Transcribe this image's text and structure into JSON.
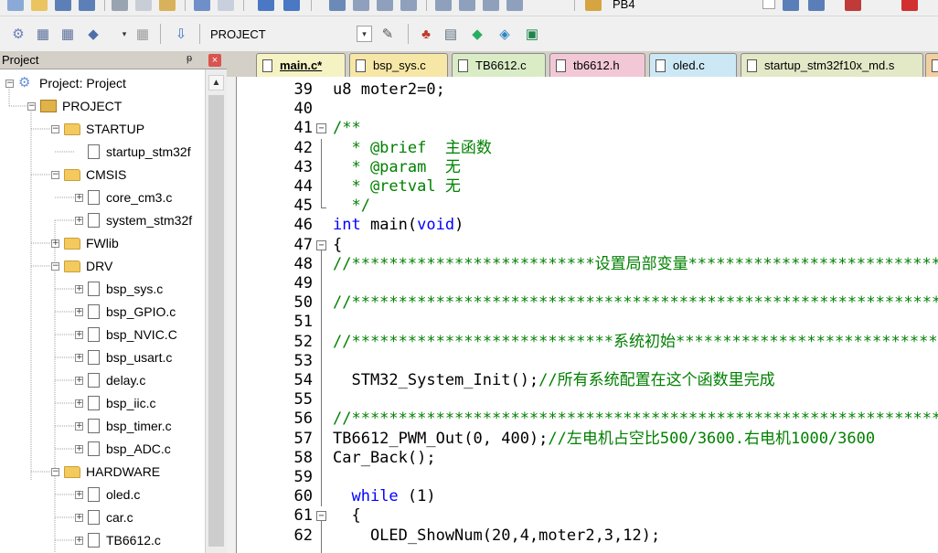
{
  "toolbar1": {
    "partial_label": "PB4"
  },
  "toolbar2": {
    "target_name": "PROJECT"
  },
  "project_panel": {
    "title": "Project",
    "pin_glyph": "ᵽ",
    "tree": [
      {
        "label": "Project: Project",
        "level": 0,
        "kind": "root"
      },
      {
        "label": "PROJECT",
        "level": 1,
        "kind": "target"
      },
      {
        "label": "STARTUP",
        "level": 2,
        "kind": "folder"
      },
      {
        "label": "startup_stm32f",
        "level": 3,
        "kind": "file-noexp"
      },
      {
        "label": "CMSIS",
        "level": 2,
        "kind": "folder"
      },
      {
        "label": "core_cm3.c",
        "level": 3,
        "kind": "file"
      },
      {
        "label": "system_stm32f",
        "level": 3,
        "kind": "file"
      },
      {
        "label": "FWlib",
        "level": 2,
        "kind": "folder-collapsed"
      },
      {
        "label": "DRV",
        "level": 2,
        "kind": "folder"
      },
      {
        "label": "bsp_sys.c",
        "level": 3,
        "kind": "file"
      },
      {
        "label": "bsp_GPIO.c",
        "level": 3,
        "kind": "file"
      },
      {
        "label": "bsp_NVIC.C",
        "level": 3,
        "kind": "file"
      },
      {
        "label": "bsp_usart.c",
        "level": 3,
        "kind": "file"
      },
      {
        "label": "delay.c",
        "level": 3,
        "kind": "file"
      },
      {
        "label": "bsp_iic.c",
        "level": 3,
        "kind": "file"
      },
      {
        "label": "bsp_timer.c",
        "level": 3,
        "kind": "file"
      },
      {
        "label": "bsp_ADC.c",
        "level": 3,
        "kind": "file"
      },
      {
        "label": "HARDWARE",
        "level": 2,
        "kind": "folder"
      },
      {
        "label": "oled.c",
        "level": 3,
        "kind": "file"
      },
      {
        "label": "car.c",
        "level": 3,
        "kind": "file"
      },
      {
        "label": "TB6612.c",
        "level": 3,
        "kind": "file"
      }
    ]
  },
  "tabs": [
    {
      "label": "main.c*",
      "active": true,
      "color": "#f5f3c4"
    },
    {
      "label": "bsp_sys.c",
      "active": false,
      "color": "#f6e7a6"
    },
    {
      "label": "TB6612.c",
      "active": false,
      "color": "#d9ecc6"
    },
    {
      "label": "tb6612.h",
      "active": false,
      "color": "#f2c8d6"
    },
    {
      "label": "oled.c",
      "active": false,
      "color": "#cde8f5"
    },
    {
      "label": "startup_stm32f10x_md.s",
      "active": false,
      "color": "#e3e8c7"
    },
    {
      "label": "",
      "active": false,
      "color": "#f2cfa0"
    }
  ],
  "editor": {
    "lines": [
      {
        "n": "39",
        "fold": "",
        "segments": [
          {
            "t": "u8 moter2=0;",
            "c": ""
          }
        ]
      },
      {
        "n": "40",
        "fold": "",
        "segments": []
      },
      {
        "n": "41",
        "fold": "minus",
        "segments": [
          {
            "t": "/**",
            "c": "cm"
          }
        ]
      },
      {
        "n": "42",
        "fold": "line",
        "segments": [
          {
            "t": "  * @brief  主函数",
            "c": "cm"
          }
        ]
      },
      {
        "n": "43",
        "fold": "line",
        "segments": [
          {
            "t": "  * @param  无",
            "c": "cm"
          }
        ]
      },
      {
        "n": "44",
        "fold": "line",
        "segments": [
          {
            "t": "  * @retval 无",
            "c": "cm"
          }
        ]
      },
      {
        "n": "45",
        "fold": "end",
        "segments": [
          {
            "t": "  */",
            "c": "cm"
          }
        ]
      },
      {
        "n": "46",
        "fold": "",
        "segments": [
          {
            "t": "int",
            "c": "kw"
          },
          {
            "t": " main(",
            "c": ""
          },
          {
            "t": "void",
            "c": "kw"
          },
          {
            "t": ")",
            "c": ""
          }
        ]
      },
      {
        "n": "47",
        "fold": "minus",
        "segments": [
          {
            "t": "{",
            "c": ""
          }
        ]
      },
      {
        "n": "48",
        "fold": "",
        "segments": [
          {
            "t": "//**************************设置局部变量*******************************",
            "c": "cm"
          }
        ]
      },
      {
        "n": "49",
        "fold": "",
        "segments": []
      },
      {
        "n": "50",
        "fold": "",
        "segments": [
          {
            "t": "//**********************************************************************",
            "c": "cm"
          }
        ]
      },
      {
        "n": "51",
        "fold": "",
        "segments": []
      },
      {
        "n": "52",
        "fold": "",
        "segments": [
          {
            "t": "//****************************系统初始********************************",
            "c": "cm"
          }
        ]
      },
      {
        "n": "53",
        "fold": "",
        "segments": []
      },
      {
        "n": "54",
        "fold": "",
        "segments": [
          {
            "t": "  STM32_System_Init();",
            "c": ""
          },
          {
            "t": "//所有系统配置在这个函数里完成",
            "c": "cm"
          }
        ]
      },
      {
        "n": "55",
        "fold": "",
        "segments": []
      },
      {
        "n": "56",
        "fold": "",
        "segments": [
          {
            "t": "//**********************************************************************",
            "c": "cm"
          }
        ]
      },
      {
        "n": "57",
        "fold": "",
        "segments": [
          {
            "t": "TB6612_PWM_Out(0, 400);",
            "c": ""
          },
          {
            "t": "//左电机占空比500/3600.右电机1000/3600",
            "c": "cm"
          }
        ]
      },
      {
        "n": "58",
        "fold": "",
        "segments": [
          {
            "t": "Car_Back();",
            "c": ""
          }
        ]
      },
      {
        "n": "59",
        "fold": "",
        "segments": []
      },
      {
        "n": "60",
        "fold": "",
        "segments": [
          {
            "t": "  ",
            "c": ""
          },
          {
            "t": "while",
            "c": "kw"
          },
          {
            "t": " (1)",
            "c": ""
          }
        ]
      },
      {
        "n": "61",
        "fold": "minus",
        "segments": [
          {
            "t": "  {",
            "c": ""
          }
        ]
      },
      {
        "n": "62",
        "fold": "",
        "segments": [
          {
            "t": "    OLED_ShowNum(20,4,moter2,3,12);",
            "c": ""
          }
        ]
      }
    ]
  }
}
